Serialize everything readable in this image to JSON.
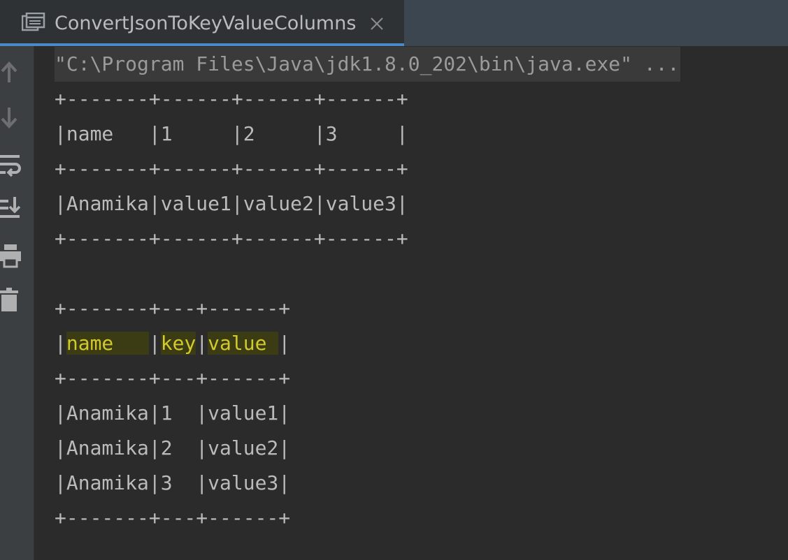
{
  "tab": {
    "title": "ConvertJsonToKeyValueColumns",
    "icon": "console-window-icon",
    "close_icon": "close-icon"
  },
  "toolbar": {
    "icons": [
      "arrow-up-icon",
      "arrow-down-icon",
      "soft-wrap-icon",
      "scroll-to-end-icon",
      "print-icon",
      "trash-icon"
    ]
  },
  "console": {
    "command": "\"C:\\Program Files\\Java\\jdk1.8.0_202\\bin\\java.exe\" ...",
    "table1": {
      "border": "+-------+------+------+------+",
      "header_row": "|name   |1     |2     |3     |",
      "data_row": "|Anamika|value1|value2|value3|"
    },
    "table2": {
      "border": "+-------+---+------+",
      "header_cells": {
        "sep": "|",
        "name": "name   ",
        "key": "key",
        "value": "value ",
        "end": "|"
      },
      "rows": [
        "|Anamika|1  |value1|",
        "|Anamika|2  |value2|",
        "|Anamika|3  |value3|"
      ]
    }
  }
}
